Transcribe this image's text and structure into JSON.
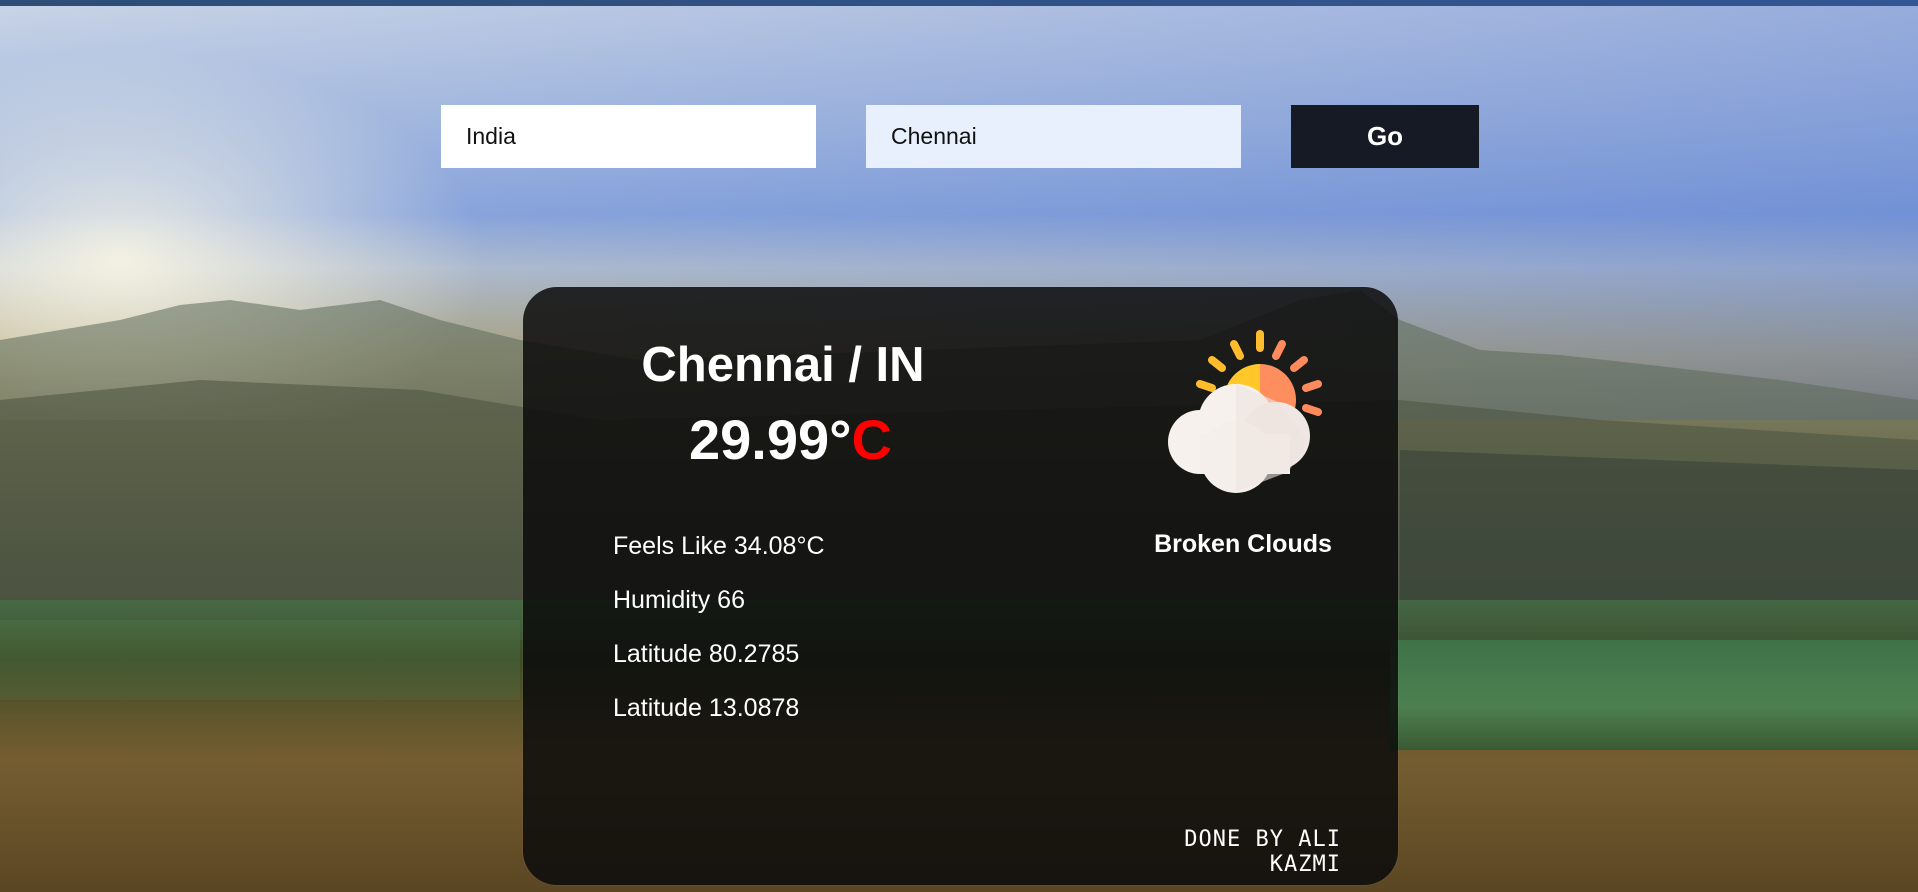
{
  "search": {
    "country_value": "India",
    "city_value": "Chennai",
    "go_label": "Go"
  },
  "weather": {
    "location": "Chennai / IN",
    "temperature_value": "29.99°",
    "temperature_unit": "C",
    "feels_like": "Feels Like 34.08°C",
    "humidity": "Humidity 66",
    "coord_1": "Latitude 80.2785",
    "coord_2": "Latitude 13.0878",
    "condition": "Broken Clouds",
    "icon": "sun-behind-cloud-icon"
  },
  "footer": {
    "credit": "DONE BY ALI KAZMI"
  },
  "colors": {
    "button_bg": "#151a24",
    "card_bg": "rgba(12,12,12,0.86)",
    "unit_accent": "#ff0000",
    "city_field_bg": "#e8f0fe"
  }
}
